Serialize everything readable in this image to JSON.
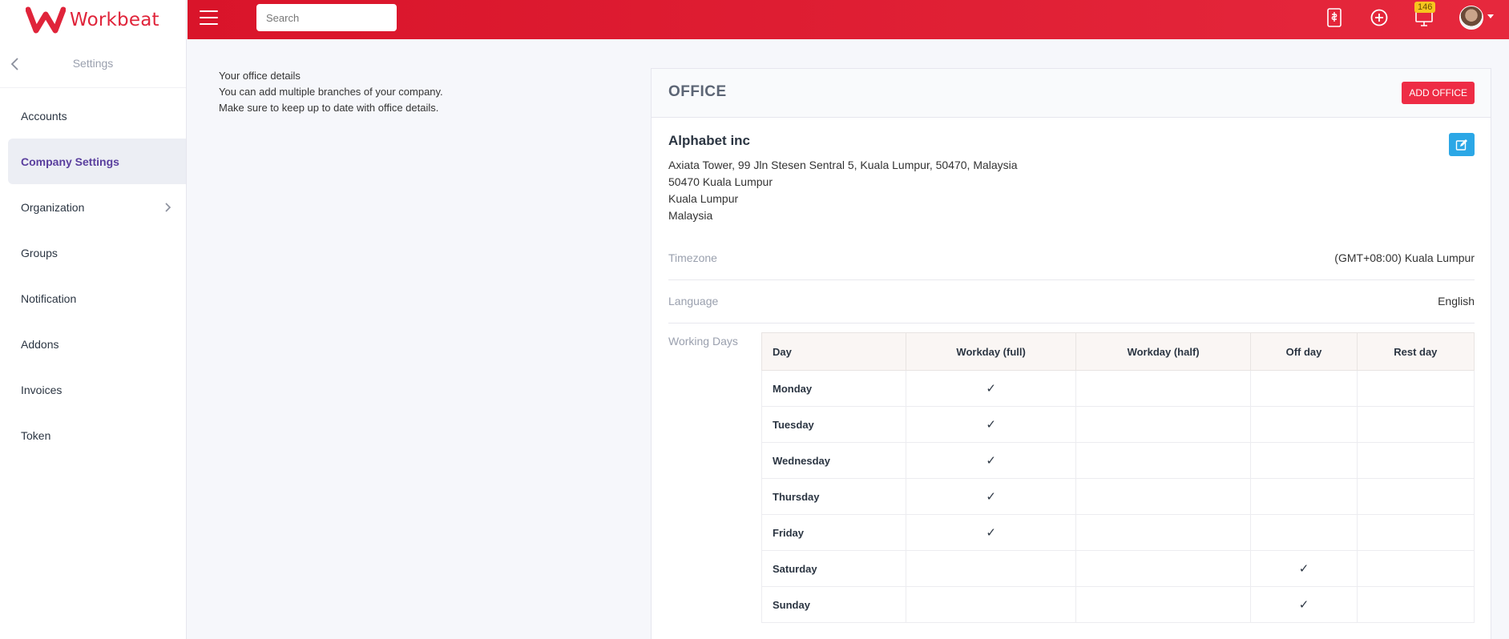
{
  "app": {
    "brand": "Workbeat"
  },
  "sidebar": {
    "title": "Settings",
    "items": [
      {
        "label": "Accounts"
      },
      {
        "label": "Company Settings"
      },
      {
        "label": "Organization"
      },
      {
        "label": "Groups"
      },
      {
        "label": "Notification"
      },
      {
        "label": "Addons"
      },
      {
        "label": "Invoices"
      },
      {
        "label": "Token"
      }
    ]
  },
  "topbar": {
    "search_placeholder": "Search",
    "notification_count": "146"
  },
  "description": {
    "line1": "Your office details",
    "line2": "You can add multiple branches of your company.",
    "line3": "Make sure to keep up to date with office details."
  },
  "office": {
    "title": "OFFICE",
    "add_label": "ADD OFFICE",
    "company_name": "Alphabet inc",
    "address": [
      "Axiata Tower, 99 Jln Stesen Sentral 5, Kuala Lumpur, 50470, Malaysia",
      "50470 Kuala Lumpur",
      "Kuala Lumpur",
      "Malaysia"
    ],
    "timezone_label": "Timezone",
    "timezone_value": "(GMT+08:00) Kuala Lumpur",
    "language_label": "Language",
    "language_value": "English",
    "working_days_label": "Working Days",
    "table": {
      "headers": [
        "Day",
        "Workday (full)",
        "Workday (half)",
        "Off day",
        "Rest day"
      ],
      "rows": [
        [
          "Monday",
          "✓",
          "",
          "",
          ""
        ],
        [
          "Tuesday",
          "✓",
          "",
          "",
          ""
        ],
        [
          "Wednesday",
          "✓",
          "",
          "",
          ""
        ],
        [
          "Thursday",
          "✓",
          "",
          "",
          ""
        ],
        [
          "Friday",
          "✓",
          "",
          "",
          ""
        ],
        [
          "Saturday",
          "",
          "",
          "✓",
          ""
        ],
        [
          "Sunday",
          "",
          "",
          "✓",
          ""
        ]
      ]
    }
  },
  "colors": {
    "brand_red": "#e0243a",
    "active_nav_text": "#5a3f9e",
    "edit_blue": "#2ba7e6",
    "badge_yellow": "#f7c51e"
  },
  "icons": {
    "topbar": [
      "invoice-icon",
      "add-circle-icon",
      "monitor-icon",
      "avatar"
    ]
  }
}
